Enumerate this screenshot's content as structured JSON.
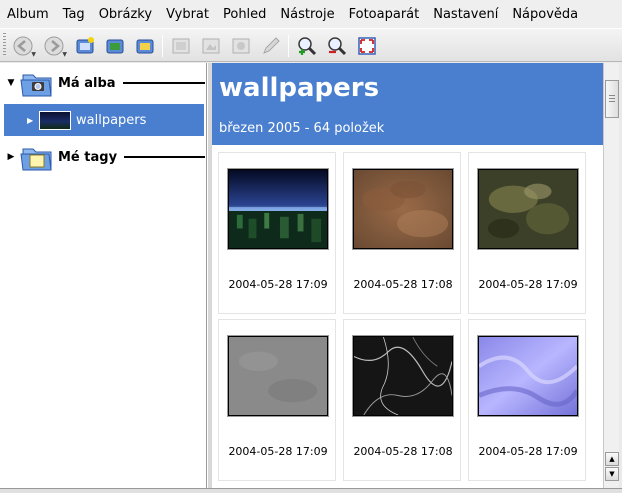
{
  "menubar": {
    "items": [
      {
        "label": "Album"
      },
      {
        "label": "Tag"
      },
      {
        "label": "Obrázky"
      },
      {
        "label": "Vybrat"
      },
      {
        "label": "Pohled"
      },
      {
        "label": "Nástroje"
      },
      {
        "label": "Fotoaparát"
      },
      {
        "label": "Nastavení"
      },
      {
        "label": "Nápověda"
      }
    ]
  },
  "toolbar": {
    "buttons": [
      "back-icon",
      "forward-icon",
      "new-album-icon",
      "album-properties-icon",
      "delete-album-icon",
      "image-view-icon",
      "image-properties-icon",
      "image-delete-icon",
      "edit-icon",
      "zoom-in-icon",
      "zoom-out-icon",
      "fullscreen-icon"
    ]
  },
  "sidebar": {
    "albums_label": "Má alba",
    "tags_label": "Mé tagy",
    "selected_album": "wallpapers"
  },
  "main": {
    "title": "wallpapers",
    "subtitle": "březen 2005 - 64 položek",
    "items": [
      {
        "date": "2004-05-28 17:09",
        "thumb": "city-night"
      },
      {
        "date": "2004-05-28 17:08",
        "thumb": "brown-texture"
      },
      {
        "date": "2004-05-28 17:09",
        "thumb": "green-texture"
      },
      {
        "date": "2004-05-28 17:09",
        "thumb": "grey-texture"
      },
      {
        "date": "2004-05-28 17:08",
        "thumb": "black-marble"
      },
      {
        "date": "2004-05-28 17:09",
        "thumb": "purple-silk"
      }
    ]
  },
  "colors": {
    "selection": "#4a7fcf",
    "banner": "#4a7fcf"
  }
}
